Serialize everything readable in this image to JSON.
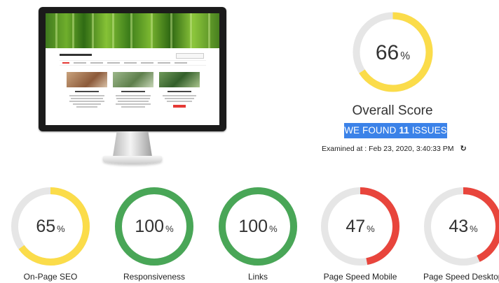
{
  "colors": {
    "track": "#e6e6e6",
    "yellow": "#fbdc4a",
    "green": "#49a657",
    "red": "#e8453c",
    "badge_bg": "#3b82e8"
  },
  "overall": {
    "score": 66,
    "unit": "%",
    "label": "Overall Score",
    "issues_prefix": "WE FOUND",
    "issues_count": "11",
    "issues_suffix": "ISSUES",
    "examined": "Examined at : Feb 23, 2020, 3:40:33 PM",
    "refresh_icon": "refresh-icon"
  },
  "metrics": [
    {
      "label": "On-Page SEO",
      "score": 65,
      "unit": "%",
      "status": "yellow"
    },
    {
      "label": "Responsiveness",
      "score": 100,
      "unit": "%",
      "status": "green"
    },
    {
      "label": "Links",
      "score": 100,
      "unit": "%",
      "status": "green"
    },
    {
      "label": "Page Speed Mobile",
      "score": 47,
      "unit": "%",
      "status": "red"
    },
    {
      "label": "Page Speed Desktop",
      "score": 43,
      "unit": "%",
      "status": "red"
    }
  ]
}
